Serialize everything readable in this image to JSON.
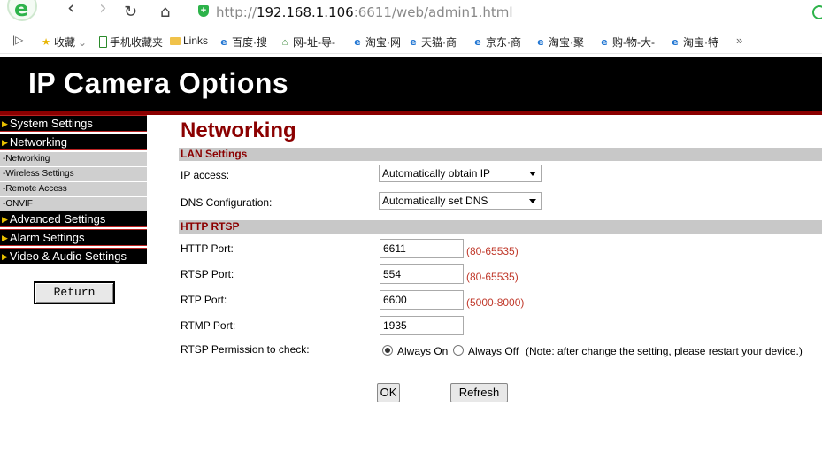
{
  "browser": {
    "logo_letter": "e",
    "back": "‹",
    "forward": "›",
    "reload": "↻",
    "home": "⌂",
    "url_scheme": "http://",
    "url_host": "192.168.1.106",
    "url_rest": ":6611/web/admin1.html",
    "bookmarks": [
      "收藏",
      "手机收藏夹",
      "Links",
      "百度·搜",
      "网-址-导-",
      "淘宝·网",
      "天猫·商",
      "京东·商",
      "淘宝·聚",
      "购-物-大-",
      "淘宝·特"
    ],
    "more": "»"
  },
  "banner": {
    "title": "IP Camera Options"
  },
  "sidebar": {
    "system_settings": "System Settings",
    "networking": "Networking",
    "sub_items": [
      "-Networking",
      "-Wireless Settings",
      "-Remote Access",
      "-ONVIF"
    ],
    "advanced_settings": "Advanced Settings",
    "alarm_settings": "Alarm Settings",
    "video_audio_settings": "Video & Audio Settings",
    "return_label": "Return"
  },
  "main": {
    "title": "Networking",
    "lan_section": "LAN Settings",
    "ip_access_label": "IP access:",
    "ip_access_value": "Automatically obtain IP",
    "dns_label": "DNS Configuration:",
    "dns_value": "Automatically set DNS",
    "rtsp_section": "HTTP RTSP",
    "http_port_label": "HTTP Port:",
    "http_port_value": "6611",
    "http_port_range": "(80-65535)",
    "rtsp_port_label": "RTSP Port:",
    "rtsp_port_value": "554",
    "rtsp_port_range": "(80-65535)",
    "rtp_port_label": "RTP Port:",
    "rtp_port_value": "6600",
    "rtp_port_range": "(5000-8000)",
    "rtmp_port_label": "RTMP Port:",
    "rtmp_port_value": "1935",
    "permission_label": "RTSP Permission to check:",
    "always_on": "Always On",
    "always_off": "Always Off",
    "note": "(Note: after change the setting, please restart your device.)",
    "ok_label": "OK",
    "refresh_label": "Refresh"
  },
  "colors": {
    "accent": "#8b0000",
    "banner": "#000000"
  }
}
